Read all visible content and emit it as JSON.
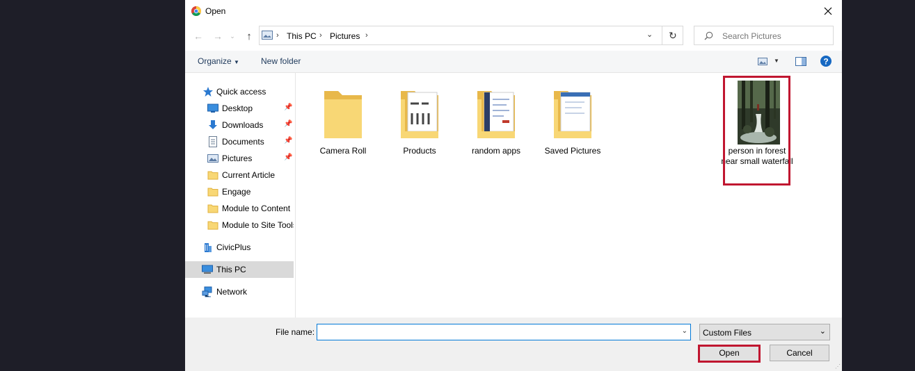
{
  "dialog": {
    "title": "Open"
  },
  "address": {
    "crumbs": [
      "This PC",
      "Pictures"
    ]
  },
  "search": {
    "placeholder": "Search Pictures"
  },
  "commands": {
    "organize": "Organize",
    "new_folder": "New folder"
  },
  "nav": {
    "quick_access": "Quick access",
    "items": [
      {
        "label": "Desktop",
        "icon": "desktop-icon",
        "pinned": true
      },
      {
        "label": "Downloads",
        "icon": "download-arrow-icon",
        "pinned": true
      },
      {
        "label": "Documents",
        "icon": "documents-icon",
        "pinned": true
      },
      {
        "label": "Pictures",
        "icon": "pictures-icon",
        "pinned": true
      },
      {
        "label": "Current Article",
        "icon": "folder-icon",
        "pinned": false
      },
      {
        "label": "Engage",
        "icon": "folder-icon",
        "pinned": false
      },
      {
        "label": "Module to Content",
        "icon": "folder-icon",
        "pinned": false
      },
      {
        "label": "Module to Site Tools",
        "icon": "folder-icon",
        "pinned": false
      }
    ],
    "civicplus": "CivicPlus",
    "this_pc": "This PC",
    "network": "Network"
  },
  "files": [
    {
      "name": "Camera Roll",
      "type": "folder"
    },
    {
      "name": "Products",
      "type": "folder"
    },
    {
      "name": "random apps",
      "type": "folder"
    },
    {
      "name": "Saved Pictures",
      "type": "folder"
    },
    {
      "name": "person in forest near small waterfall",
      "type": "image",
      "selected": true
    }
  ],
  "footer": {
    "file_name_label": "File name:",
    "file_name_value": "",
    "filter": "Custom Files",
    "open_label": "Open",
    "cancel_label": "Cancel"
  },
  "colors": {
    "highlight": "#c01630",
    "accent": "#0078d7",
    "folder": "#f8d775"
  }
}
